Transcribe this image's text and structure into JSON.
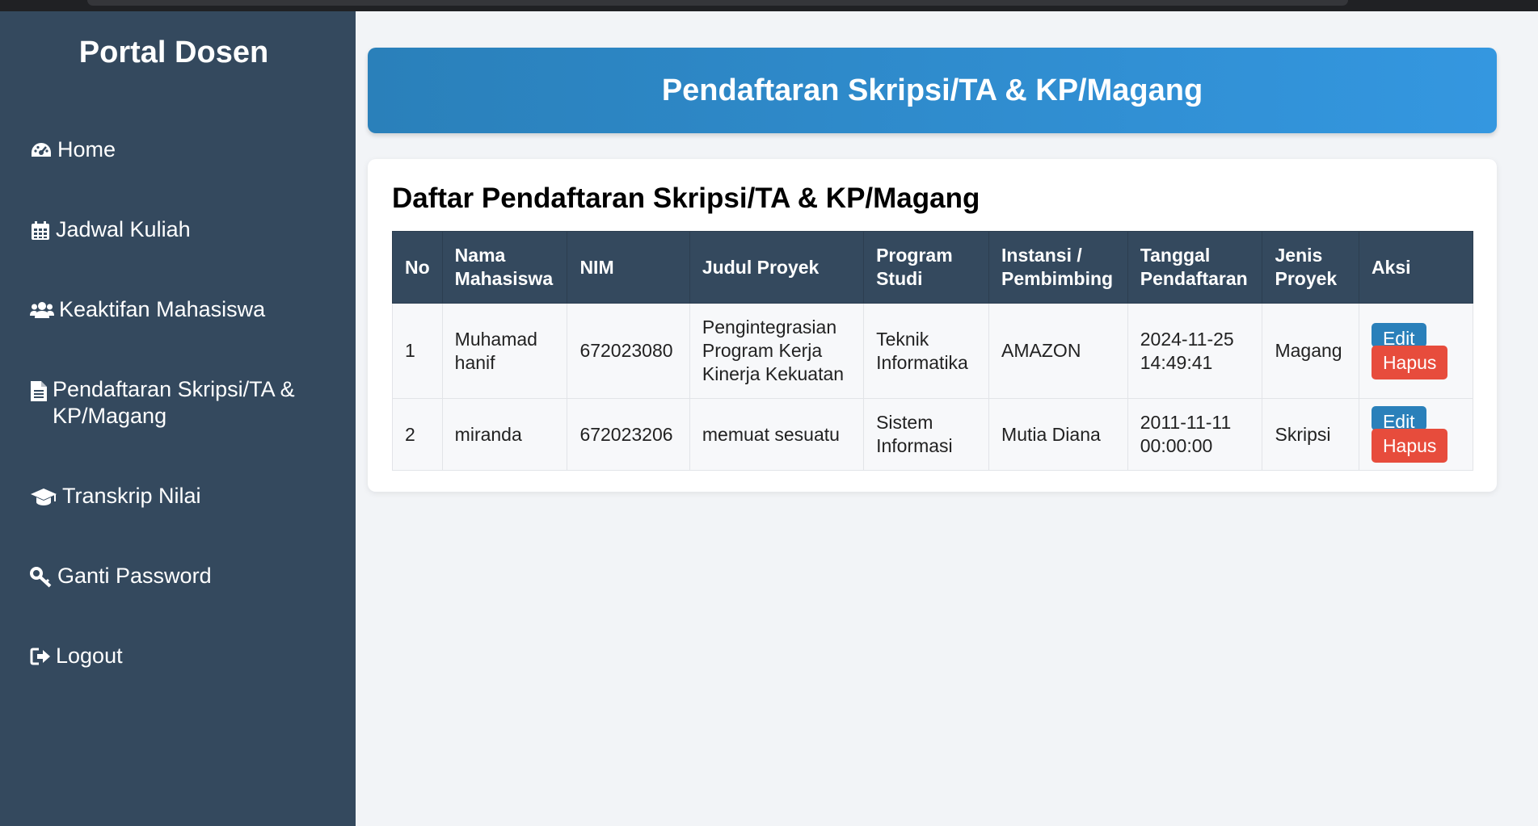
{
  "sidebar": {
    "title": "Portal Dosen",
    "items": [
      {
        "label": "Home",
        "icon": "dashboard-icon"
      },
      {
        "label": "Jadwal Kuliah",
        "icon": "calendar-icon"
      },
      {
        "label": "Keaktifan Mahasiswa",
        "icon": "users-icon"
      },
      {
        "label": "Pendaftaran Skripsi/TA & KP/Magang",
        "icon": "file-text-icon"
      },
      {
        "label": "Transkrip Nilai",
        "icon": "graduation-cap-icon"
      },
      {
        "label": "Ganti Password",
        "icon": "key-icon"
      },
      {
        "label": "Logout",
        "icon": "sign-out-icon"
      }
    ]
  },
  "header": {
    "title": "Pendaftaran Skripsi/TA & KP/Magang"
  },
  "card": {
    "title": "Daftar Pendaftaran Skripsi/TA & KP/Magang"
  },
  "table": {
    "columns": [
      {
        "line1": "No",
        "line2": ""
      },
      {
        "line1": "Nama",
        "line2": "Mahasiswa"
      },
      {
        "line1": "NIM",
        "line2": ""
      },
      {
        "line1": "Judul Proyek",
        "line2": ""
      },
      {
        "line1": "Program",
        "line2": "Studi"
      },
      {
        "line1": "Instansi /",
        "line2": "Pembimbing"
      },
      {
        "line1": "Tanggal",
        "line2": "Pendaftaran"
      },
      {
        "line1": "Jenis",
        "line2": "Proyek"
      },
      {
        "line1": "Aksi",
        "line2": ""
      }
    ],
    "rows": [
      {
        "no": "1",
        "nama": [
          "Muhamad",
          "hanif"
        ],
        "nim": "672023080",
        "judul": [
          "Pengintegrasian",
          "Program Kerja",
          "Kinerja Kekuatan"
        ],
        "prodi": [
          "Teknik",
          "Informatika"
        ],
        "instansi": "AMAZON",
        "tanggal": [
          "2024-11-25",
          "14:49:41"
        ],
        "jenis": "Magang"
      },
      {
        "no": "2",
        "nama": [
          "miranda"
        ],
        "nim": "672023206",
        "judul": [
          "memuat sesuatu"
        ],
        "prodi": [
          "Sistem",
          "Informasi"
        ],
        "instansi": "Mutia Diana",
        "tanggal": [
          "2011-11-11",
          "00:00:00"
        ],
        "jenis": "Skripsi"
      }
    ],
    "edit_label": "Edit",
    "delete_label": "Hapus"
  },
  "colors": {
    "sidebar_bg": "#34495e",
    "header_gradient_start": "#2a80ba",
    "header_gradient_end": "#3497e0",
    "edit_button": "#2a80ba",
    "delete_button": "#e74c3c"
  }
}
